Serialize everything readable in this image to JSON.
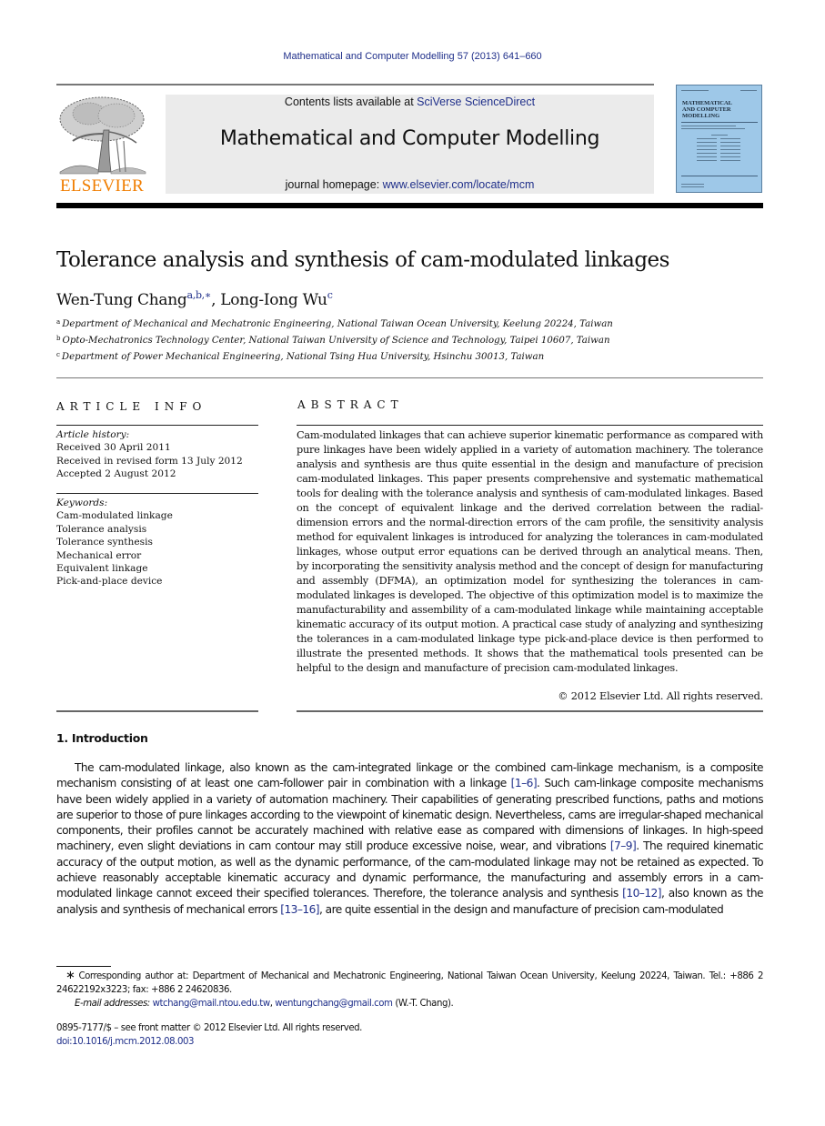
{
  "header": {
    "journal_reference": "Mathematical and Computer Modelling 57 (2013) 641–660",
    "contents_prefix": "Contents lists available at ",
    "contents_link": "SciVerse ScienceDirect",
    "journal_title": "Mathematical and Computer Modelling",
    "homepage_prefix": "journal homepage: ",
    "homepage_link": "www.elsevier.com/locate/mcm",
    "publisher_logo_text": "ELSEVIER",
    "cover_title_lines": [
      "MATHEMATICAL",
      "AND COMPUTER",
      "MODELLING"
    ]
  },
  "article": {
    "title": "Tolerance analysis and synthesis of cam-modulated linkages",
    "authors": [
      {
        "name": "Wen-Tung Chang",
        "marks": "a,b,∗"
      },
      {
        "name": "Long-Iong Wu",
        "marks": "c"
      }
    ],
    "author_separator": ", ",
    "affiliations": [
      {
        "mark": "a",
        "text": "Department of Mechanical and Mechatronic Engineering, National Taiwan Ocean University, Keelung 20224, Taiwan"
      },
      {
        "mark": "b",
        "text": "Opto-Mechatronics Technology Center, National Taiwan University of Science and Technology, Taipei 10607, Taiwan"
      },
      {
        "mark": "c",
        "text": "Department of Power Mechanical Engineering, National Tsing Hua University, Hsinchu 30013, Taiwan"
      }
    ]
  },
  "article_info": {
    "heading": "ARTICLE INFO",
    "history_label": "Article history:",
    "history": [
      "Received 30 April 2011",
      "Received in revised form 13 July 2012",
      "Accepted 2 August 2012"
    ],
    "keywords_label": "Keywords:",
    "keywords": [
      "Cam-modulated linkage",
      "Tolerance analysis",
      "Tolerance synthesis",
      "Mechanical error",
      "Equivalent linkage",
      "Pick-and-place device"
    ]
  },
  "abstract": {
    "heading": "ABSTRACT",
    "text": "Cam-modulated linkages that can achieve superior kinematic performance as compared with pure linkages have been widely applied in a variety of automation machinery. The tolerance analysis and synthesis are thus quite essential in the design and manufacture of precision cam-modulated linkages. This paper presents comprehensive and systematic mathematical tools for dealing with the tolerance analysis and synthesis of cam-modulated linkages. Based on the concept of equivalent linkage and the derived correlation between the radial-dimension errors and the normal-direction errors of the cam profile, the sensitivity analysis method for equivalent linkages is introduced for analyzing the tolerances in cam-modulated linkages, whose output error equations can be derived through an analytical means. Then, by incorporating the sensitivity analysis method and the concept of design for manufacturing and assembly (DFMA), an optimization model for synthesizing the tolerances in cam-modulated linkages is developed. The objective of this optimization model is to maximize the manufacturability and assembility of a cam-modulated linkage while maintaining acceptable kinematic accuracy of its output motion. A practical case study of analyzing and synthesizing the tolerances in a cam-modulated linkage type pick-and-place device is then performed to illustrate the presented methods. It shows that the mathematical tools presented can be helpful to the design and manufacture of precision cam-modulated linkages.",
    "copyright": "© 2012 Elsevier Ltd. All rights reserved."
  },
  "introduction": {
    "heading": "1.  Introduction",
    "segments": [
      {
        "text": "The cam-modulated linkage, also known as the cam-integrated linkage or the combined cam-linkage mechanism, is a composite mechanism consisting of at least one cam-follower pair in combination with a linkage ",
        "ref": false
      },
      {
        "text": "[1–6]",
        "ref": true
      },
      {
        "text": ". Such cam-linkage composite mechanisms have been widely applied in a variety of automation machinery. Their capabilities of generating prescribed functions, paths and motions are superior to those of pure linkages according to the viewpoint of kinematic design. Nevertheless, cams are irregular-shaped mechanical components, their profiles cannot be accurately machined with relative ease as compared with dimensions of linkages. In high-speed machinery, even slight deviations in cam contour may still produce excessive noise, wear, and vibrations ",
        "ref": false
      },
      {
        "text": "[7–9]",
        "ref": true
      },
      {
        "text": ". The required kinematic accuracy of the output motion, as well as the dynamic performance, of the cam-modulated linkage may not be retained as expected. To achieve reasonably acceptable kinematic accuracy and dynamic performance, the manufacturing and assembly errors in a cam-modulated linkage cannot exceed their specified tolerances. Therefore, the tolerance analysis and synthesis ",
        "ref": false
      },
      {
        "text": "[10–12]",
        "ref": true
      },
      {
        "text": ", also known as the analysis and synthesis of mechanical errors ",
        "ref": false
      },
      {
        "text": "[13–16]",
        "ref": true
      },
      {
        "text": ", are quite essential in the design and manufacture of precision cam-modulated",
        "ref": false
      }
    ]
  },
  "footnotes": {
    "star": "∗",
    "corresponding": "Corresponding author at: Department of Mechanical and Mechatronic Engineering, National Taiwan Ocean University, Keelung 20224, Taiwan. Tel.: +886 2 24622192x3223; fax: +886 2 24620836.",
    "email_label": "E-mail addresses: ",
    "emails": [
      "wtchang@mail.ntou.edu.tw",
      "wentungchang@gmail.com"
    ],
    "email_separator": ", ",
    "email_suffix": " (W.-T. Chang).",
    "front_matter": "0895-7177/$ – see front matter © 2012 Elsevier Ltd. All rights reserved.",
    "doi": "doi:10.1016/j.mcm.2012.08.003"
  }
}
